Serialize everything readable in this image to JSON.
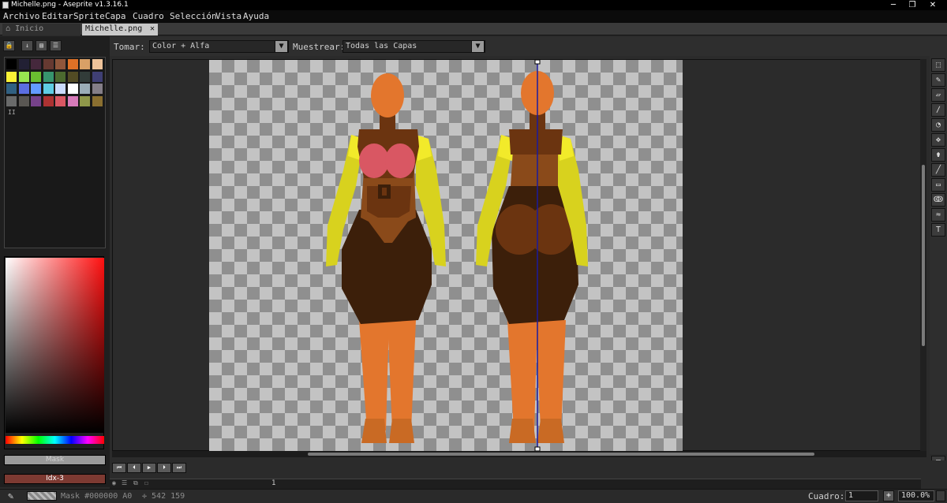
{
  "window": {
    "title": "Michelle.png - Aseprite v1.3.16.1",
    "minimize": "─",
    "maximize": "❐",
    "close": "✕"
  },
  "menu": [
    "Archivo",
    "Editar",
    "Sprite",
    "Capa",
    "Cuadro",
    "Selección",
    "Vista",
    "Ayuda"
  ],
  "tabs": [
    {
      "label": "Inicio",
      "icon": "home-icon",
      "active": false
    },
    {
      "label": "Michelle.png",
      "active": true,
      "close": "✕"
    }
  ],
  "context_bar": {
    "tomar_label": "Tomar:",
    "tomar_value": "Color + Alfa",
    "muestrear_label": "Muestrear:",
    "muestrear_value": "Todas las Capas"
  },
  "palette": {
    "colors": [
      "#000000",
      "#222034",
      "#45283c",
      "#663931",
      "#8f563b",
      "#df7126",
      "#d9a066",
      "#eec39a",
      "#fbf236",
      "#99e550",
      "#6abe30",
      "#37946e",
      "#4b692f",
      "#524b24",
      "#323c39",
      "#3f3f74",
      "#306082",
      "#5b6ee1",
      "#639bff",
      "#5fcde4",
      "#cbdbfc",
      "#ffffff",
      "#9badb7",
      "#847e87",
      "#696a6a",
      "#595652",
      "#76428a",
      "#ac3232",
      "#d95763",
      "#d77bba",
      "#8f974a",
      "#8a6f30"
    ],
    "marker": "II"
  },
  "color_bars": {
    "fg_label": "Mask",
    "bg_label": "Idx-3",
    "fg_color": "#9a9a9a",
    "bg_color": "#7d3a32"
  },
  "tools": [
    "rectangular-marquee-icon",
    "pencil-icon",
    "eraser-icon",
    "eyedropper-icon",
    "zoom-icon",
    "move-icon",
    "paint-bucket-icon",
    "line-icon",
    "rectangle-icon",
    "lasso-icon",
    "blur-icon",
    "text-icon"
  ],
  "tool_glyphs": [
    "⬚",
    "✎",
    "▱",
    "∕",
    "◔",
    "✥",
    "⚱",
    "╱",
    "▭",
    "ↂ",
    "≈",
    "T"
  ],
  "timeline": {
    "buttons": [
      "⏮",
      "⏴",
      "▶",
      "⏵",
      "⏭"
    ],
    "frame_number": "1",
    "cel_flags": [
      "◉",
      "☰",
      "⧉",
      "☐"
    ]
  },
  "status": {
    "mask_text": "Mask #000000 A0",
    "coords": "✛ 542 159",
    "frame_label": "Cuadro:",
    "frame_value": "1",
    "zoom_value": "100.0%",
    "add_frame": "+"
  },
  "left_buttons": [
    "🔒",
    "↓",
    "▤",
    "☰"
  ],
  "sprite_colors": {
    "skin": "#e3762d",
    "skin_shadow": "#c96a24",
    "jacket": "#d8d21e",
    "jacket_light": "#f2ea2a",
    "bra": "#d95763",
    "body_dark": "#3c1f0a",
    "body_mid": "#6b3410",
    "body_shade": "#8a4a1a",
    "guide": "#1a1aa0"
  }
}
